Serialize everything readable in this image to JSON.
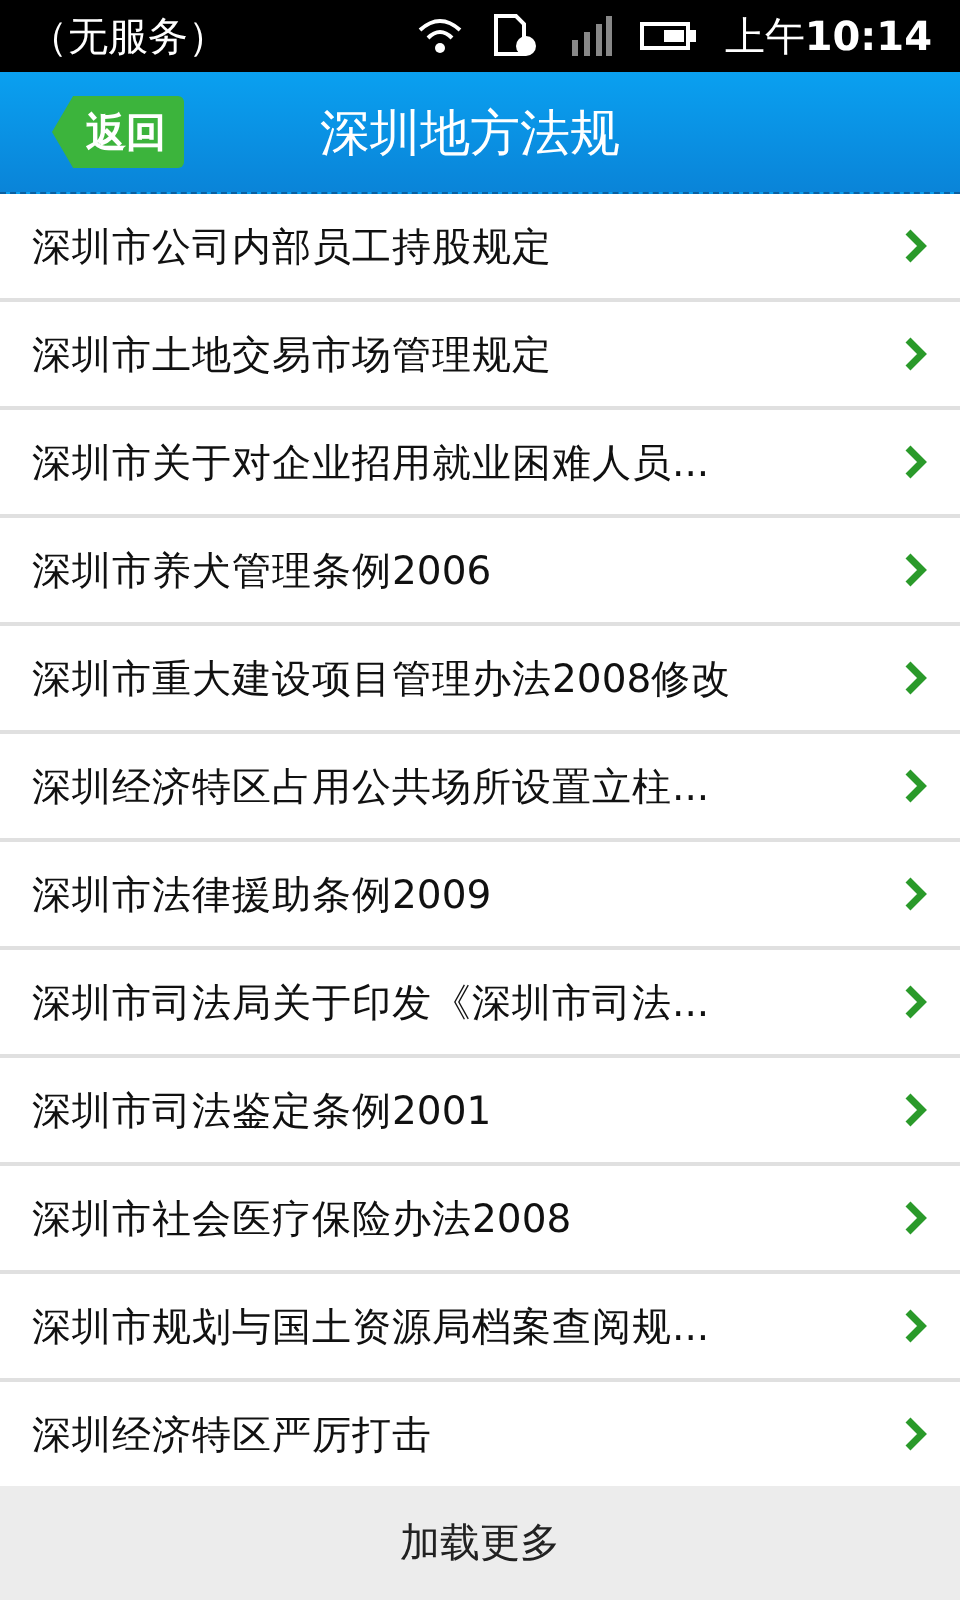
{
  "status_bar": {
    "carrier": "（无服务）",
    "clock": "上午**10:14**"
  },
  "header": {
    "back_button": "返回",
    "title": "深圳地方法规"
  },
  "items": [
    {
      "title": "深圳市公司内部员工持股规定"
    },
    {
      "title": "深圳市土地交易市场管理规定"
    },
    {
      "title": "深圳市关于对企业招用就业困难人员..."
    },
    {
      "title": "深圳市养犬管理条例2006"
    },
    {
      "title": "深圳市重大建设项目管理办法2008修改"
    },
    {
      "title": "深圳经济特区占用公共场所设置立柱..."
    },
    {
      "title": "深圳市法律援助条例2009"
    },
    {
      "title": "深圳市司法局关于印发《深圳市司法..."
    },
    {
      "title": "深圳市司法鉴定条例2001"
    },
    {
      "title": "深圳市社会医疗保险办法2008"
    },
    {
      "title": "深圳市规划与国土资源局档案查阅规..."
    },
    {
      "title": "深圳经济特区严厉打击"
    }
  ],
  "load_more": "加载更多"
}
